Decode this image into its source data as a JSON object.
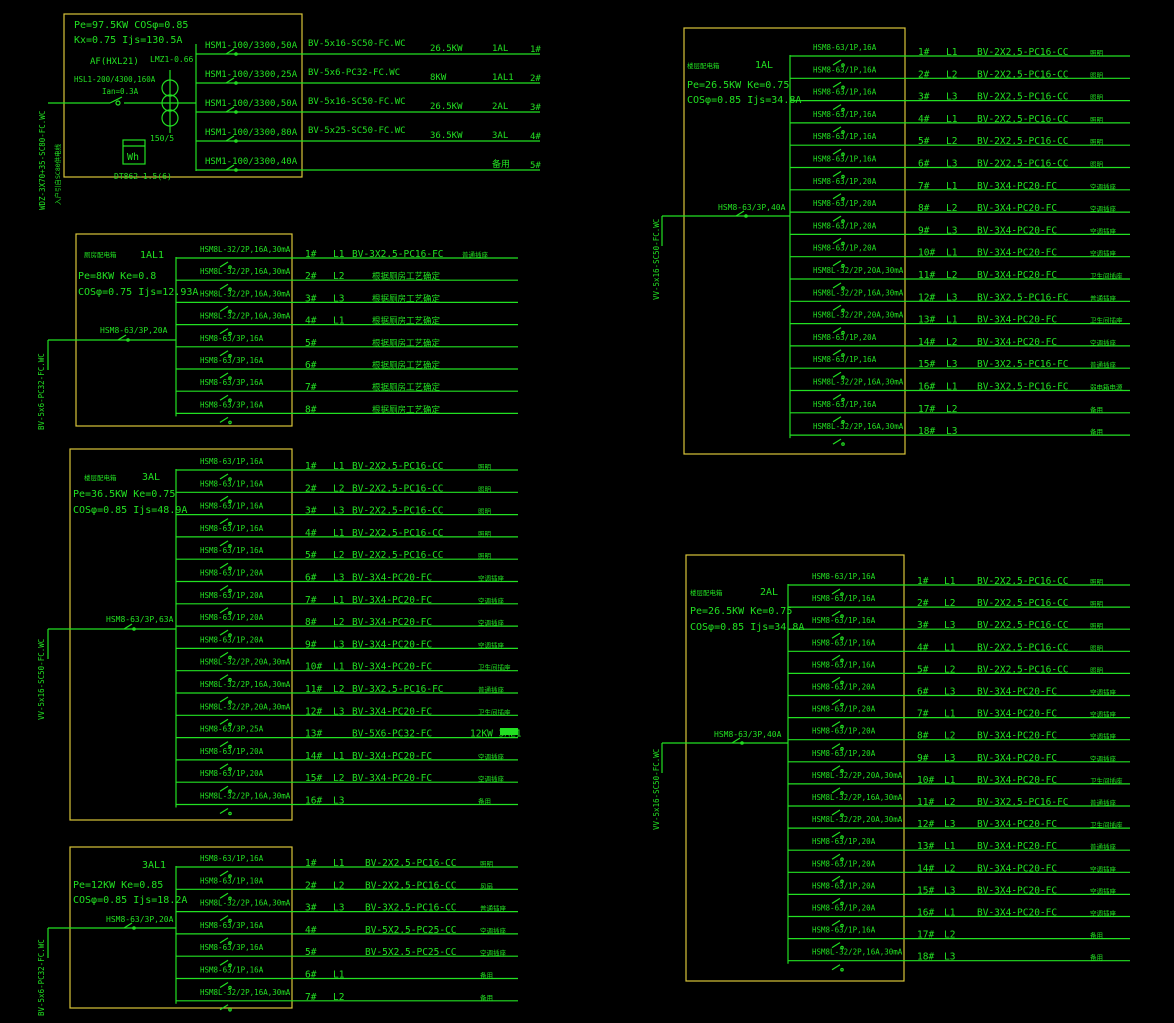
{
  "colors": {
    "background": "#000000",
    "lines": "#22e022",
    "frames": "#d8c43a"
  },
  "main": {
    "params1": "Pe=97.5KW  COSφ=0.85",
    "params2": "Kx=0.75    Ijs=130.5A",
    "meter_box": "AF(HXL21)",
    "ct": "LMZ1-0.66",
    "breaker": "HSL1-200/4300,160A",
    "breaker_in": "Ian=0.3A",
    "ct_ratio": "150/5",
    "meter_icon": "Wh",
    "meter": "DT862-1.5(6)",
    "incoming": "WDZ-3X70+35-SC80-FC.WC",
    "incoming_note": "入户引自SC80供电线",
    "rows": [
      {
        "breaker": "HSM1-100/3300,50A",
        "cable": "BV-5x16-SC50-FC.WC",
        "kw": "26.5KW",
        "dest": "1AL",
        "no": "1#"
      },
      {
        "breaker": "HSM1-100/3300,25A",
        "cable": "BV-5x6-PC32-FC.WC",
        "kw": "8KW",
        "dest": "1AL1",
        "no": "2#"
      },
      {
        "breaker": "HSM1-100/3300,50A",
        "cable": "BV-5x16-SC50-FC.WC",
        "kw": "26.5KW",
        "dest": "2AL",
        "no": "3#"
      },
      {
        "breaker": "HSM1-100/3300,80A",
        "cable": "BV-5x25-SC50-FC.WC",
        "kw": "36.5KW",
        "dest": "3AL",
        "no": "4#"
      },
      {
        "breaker": "HSM1-100/3300,40A",
        "cable": "",
        "kw": "",
        "dest": "备用",
        "no": "5#"
      }
    ]
  },
  "panels": [
    {
      "id": "1AL1",
      "label_small": "厕房配电箱",
      "title": "1AL1",
      "params": [
        "Pe=8KW Ke=0.8",
        "COSφ=0.75 Ijs=12.93A"
      ],
      "main_breaker": "HSM8-63/3P,20A",
      "incoming": "BV-5x6-PC32-FC.WC",
      "rows": [
        {
          "breaker": "HSM8L-32/2P,16A,30mA",
          "no": "1#",
          "phase": "L1",
          "cable": "BV-3X2.5-PC16-FC",
          "use": "普通插座"
        },
        {
          "breaker": "HSM8L-32/2P,16A,30mA",
          "no": "2#",
          "phase": "L2",
          "cable": "根据厕房工艺确定",
          "use": ""
        },
        {
          "breaker": "HSM8L-32/2P,16A,30mA",
          "no": "3#",
          "phase": "L3",
          "cable": "根据厕房工艺确定",
          "use": ""
        },
        {
          "breaker": "HSM8L-32/2P,16A,30mA",
          "no": "4#",
          "phase": "L1",
          "cable": "根据厕房工艺确定",
          "use": ""
        },
        {
          "breaker": "HSM8-63/3P,16A",
          "no": "5#",
          "phase": "",
          "cable": "根据厕房工艺确定",
          "use": ""
        },
        {
          "breaker": "HSM8-63/3P,16A",
          "no": "6#",
          "phase": "",
          "cable": "根据厕房工艺确定",
          "use": ""
        },
        {
          "breaker": "HSM8-63/3P,16A",
          "no": "7#",
          "phase": "",
          "cable": "根据厕房工艺确定",
          "use": ""
        },
        {
          "breaker": "HSM8-63/3P,16A",
          "no": "8#",
          "phase": "",
          "cable": "根据厕房工艺确定",
          "use": ""
        }
      ]
    },
    {
      "id": "3AL",
      "label_small": "楼层配电箱",
      "title": "3AL",
      "params": [
        "Pe=36.5KW Ke=0.75",
        "COSφ=0.85 Ijs=48.9A"
      ],
      "main_breaker": "HSM8-63/3P,63A",
      "incoming": "VV-5x16-SC50-FC.WC",
      "rows": [
        {
          "breaker": "HSM8-63/1P,16A",
          "no": "1#",
          "phase": "L1",
          "cable": "BV-2X2.5-PC16-CC",
          "use": "照明"
        },
        {
          "breaker": "HSM8-63/1P,16A",
          "no": "2#",
          "phase": "L2",
          "cable": "BV-2X2.5-PC16-CC",
          "use": "照明"
        },
        {
          "breaker": "HSM8-63/1P,16A",
          "no": "3#",
          "phase": "L3",
          "cable": "BV-2X2.5-PC16-CC",
          "use": "照明"
        },
        {
          "breaker": "HSM8-63/1P,16A",
          "no": "4#",
          "phase": "L1",
          "cable": "BV-2X2.5-PC16-CC",
          "use": "照明"
        },
        {
          "breaker": "HSM8-63/1P,16A",
          "no": "5#",
          "phase": "L2",
          "cable": "BV-2X2.5-PC16-CC",
          "use": "照明"
        },
        {
          "breaker": "HSM8-63/1P,20A",
          "no": "6#",
          "phase": "L3",
          "cable": "BV-3X4-PC20-FC",
          "use": "空调插座"
        },
        {
          "breaker": "HSM8-63/1P,20A",
          "no": "7#",
          "phase": "L1",
          "cable": "BV-3X4-PC20-FC",
          "use": "空调插座"
        },
        {
          "breaker": "HSM8-63/1P,20A",
          "no": "8#",
          "phase": "L2",
          "cable": "BV-3X4-PC20-FC",
          "use": "空调插座"
        },
        {
          "breaker": "HSM8-63/1P,20A",
          "no": "9#",
          "phase": "L3",
          "cable": "BV-3X4-PC20-FC",
          "use": "空调插座"
        },
        {
          "breaker": "HSM8L-32/2P,20A,30mA",
          "no": "10#",
          "phase": "L1",
          "cable": "BV-3X4-PC20-FC",
          "use": "卫生间插座"
        },
        {
          "breaker": "HSM8L-32/2P,16A,30mA",
          "no": "11#",
          "phase": "L2",
          "cable": "BV-3X2.5-PC16-FC",
          "use": "普通插座"
        },
        {
          "breaker": "HSM8L-32/2P,20A,30mA",
          "no": "12#",
          "phase": "L3",
          "cable": "BV-3X4-PC20-FC",
          "use": "卫生间插座"
        },
        {
          "breaker": "HSM8-63/3P,25A",
          "no": "13#",
          "phase": "",
          "cable": "BV-5X6-PC32-FC",
          "use": "12KW  3AL1"
        },
        {
          "breaker": "HSM8-63/1P,20A",
          "no": "14#",
          "phase": "L1",
          "cable": "BV-3X4-PC20-FC",
          "use": "空调插座"
        },
        {
          "breaker": "HSM8-63/1P,20A",
          "no": "15#",
          "phase": "L2",
          "cable": "BV-3X4-PC20-FC",
          "use": "空调插座"
        },
        {
          "breaker": "HSM8L-32/2P,16A,30mA",
          "no": "16#",
          "phase": "L3",
          "cable": "",
          "use": "备用"
        }
      ]
    },
    {
      "id": "3AL1",
      "label_small": "",
      "title": "3AL1",
      "params": [
        "Pe=12KW Ke=0.85",
        "COSφ=0.85 Ijs=18.2A"
      ],
      "main_breaker": "HSM8-63/3P,20A",
      "incoming": "BV-5x6-PC32-FC.WC",
      "rows": [
        {
          "breaker": "HSM8-63/1P,16A",
          "no": "1#",
          "phase": "L1",
          "cable": "BV-2X2.5-PC16-CC",
          "use": "照明"
        },
        {
          "breaker": "HSM8-63/1P,10A",
          "no": "2#",
          "phase": "L2",
          "cable": "BV-2X2.5-PC16-CC",
          "use": "风扇"
        },
        {
          "breaker": "HSM8L-32/2P,16A,30mA",
          "no": "3#",
          "phase": "L3",
          "cable": "BV-3X2.5-PC16-CC",
          "use": "普通插座"
        },
        {
          "breaker": "HSM8-63/3P,16A",
          "no": "4#",
          "phase": "",
          "cable": "BV-5X2.5-PC25-CC",
          "use": "空调插座"
        },
        {
          "breaker": "HSM8-63/3P,16A",
          "no": "5#",
          "phase": "",
          "cable": "BV-5X2.5-PC25-CC",
          "use": "空调插座"
        },
        {
          "breaker": "HSM8-63/1P,16A",
          "no": "6#",
          "phase": "L1",
          "cable": "",
          "use": "备用"
        },
        {
          "breaker": "HSM8L-32/2P,16A,30mA",
          "no": "7#",
          "phase": "L2",
          "cable": "",
          "use": "备用"
        }
      ]
    },
    {
      "id": "1AL",
      "label_small": "楼层配电箱",
      "title": "1AL",
      "params": [
        "Pe=26.5KW Ke=0.75",
        "COSφ=0.85 Ijs=34.8A"
      ],
      "main_breaker": "HSM8-63/3P,40A",
      "incoming": "VV-5x16-SC50-FC.WC",
      "rows": [
        {
          "breaker": "HSM8-63/1P,16A",
          "no": "1#",
          "phase": "L1",
          "cable": "BV-2X2.5-PC16-CC",
          "use": "照明"
        },
        {
          "breaker": "HSM8-63/1P,16A",
          "no": "2#",
          "phase": "L2",
          "cable": "BV-2X2.5-PC16-CC",
          "use": "照明"
        },
        {
          "breaker": "HSM8-63/1P,16A",
          "no": "3#",
          "phase": "L3",
          "cable": "BV-2X2.5-PC16-CC",
          "use": "照明"
        },
        {
          "breaker": "HSM8-63/1P,16A",
          "no": "4#",
          "phase": "L1",
          "cable": "BV-2X2.5-PC16-CC",
          "use": "照明"
        },
        {
          "breaker": "HSM8-63/1P,16A",
          "no": "5#",
          "phase": "L2",
          "cable": "BV-2X2.5-PC16-CC",
          "use": "照明"
        },
        {
          "breaker": "HSM8-63/1P,16A",
          "no": "6#",
          "phase": "L3",
          "cable": "BV-2X2.5-PC16-CC",
          "use": "照明"
        },
        {
          "breaker": "HSM8-63/1P,20A",
          "no": "7#",
          "phase": "L1",
          "cable": "BV-3X4-PC20-FC",
          "use": "空调插座"
        },
        {
          "breaker": "HSM8-63/1P,20A",
          "no": "8#",
          "phase": "L2",
          "cable": "BV-3X4-PC20-FC",
          "use": "空调插座"
        },
        {
          "breaker": "HSM8-63/1P,20A",
          "no": "9#",
          "phase": "L3",
          "cable": "BV-3X4-PC20-FC",
          "use": "空调插座"
        },
        {
          "breaker": "HSM8-63/1P,20A",
          "no": "10#",
          "phase": "L1",
          "cable": "BV-3X4-PC20-FC",
          "use": "空调插座"
        },
        {
          "breaker": "HSM8L-32/2P,20A,30mA",
          "no": "11#",
          "phase": "L2",
          "cable": "BV-3X4-PC20-FC",
          "use": "卫生间插座"
        },
        {
          "breaker": "HSM8L-32/2P,16A,30mA",
          "no": "12#",
          "phase": "L3",
          "cable": "BV-3X2.5-PC16-FC",
          "use": "普通插座"
        },
        {
          "breaker": "HSM8L-32/2P,20A,30mA",
          "no": "13#",
          "phase": "L1",
          "cable": "BV-3X4-PC20-FC",
          "use": "卫生间插座"
        },
        {
          "breaker": "HSM8-63/1P,20A",
          "no": "14#",
          "phase": "L2",
          "cable": "BV-3X4-PC20-FC",
          "use": "空调插座"
        },
        {
          "breaker": "HSM8-63/1P,16A",
          "no": "15#",
          "phase": "L3",
          "cable": "BV-3X2.5-PC16-FC",
          "use": "普通插座"
        },
        {
          "breaker": "HSM8L-32/2P,16A,30mA",
          "no": "16#",
          "phase": "L1",
          "cable": "BV-3X2.5-PC16-FC",
          "use": "弱电箱电源"
        },
        {
          "breaker": "HSM8-63/1P,16A",
          "no": "17#",
          "phase": "L2",
          "cable": "",
          "use": "备用"
        },
        {
          "breaker": "HSM8L-32/2P,16A,30mA",
          "no": "18#",
          "phase": "L3",
          "cable": "",
          "use": "备用"
        }
      ]
    },
    {
      "id": "2AL",
      "label_small": "楼层配电箱",
      "title": "2AL",
      "params": [
        "Pe=26.5KW Ke=0.75",
        "COSφ=0.85 Ijs=34.8A"
      ],
      "main_breaker": "HSM8-63/3P,40A",
      "incoming": "VV-5x16-SC50-FC.WC",
      "rows": [
        {
          "breaker": "HSM8-63/1P,16A",
          "no": "1#",
          "phase": "L1",
          "cable": "BV-2X2.5-PC16-CC",
          "use": "照明"
        },
        {
          "breaker": "HSM8-63/1P,16A",
          "no": "2#",
          "phase": "L2",
          "cable": "BV-2X2.5-PC16-CC",
          "use": "照明"
        },
        {
          "breaker": "HSM8-63/1P,16A",
          "no": "3#",
          "phase": "L3",
          "cable": "BV-2X2.5-PC16-CC",
          "use": "照明"
        },
        {
          "breaker": "HSM8-63/1P,16A",
          "no": "4#",
          "phase": "L1",
          "cable": "BV-2X2.5-PC16-CC",
          "use": "照明"
        },
        {
          "breaker": "HSM8-63/1P,16A",
          "no": "5#",
          "phase": "L2",
          "cable": "BV-2X2.5-PC16-CC",
          "use": "照明"
        },
        {
          "breaker": "HSM8-63/1P,20A",
          "no": "6#",
          "phase": "L3",
          "cable": "BV-3X4-PC20-FC",
          "use": "空调插座"
        },
        {
          "breaker": "HSM8-63/1P,20A",
          "no": "7#",
          "phase": "L1",
          "cable": "BV-3X4-PC20-FC",
          "use": "空调插座"
        },
        {
          "breaker": "HSM8-63/1P,20A",
          "no": "8#",
          "phase": "L2",
          "cable": "BV-3X4-PC20-FC",
          "use": "空调插座"
        },
        {
          "breaker": "HSM8-63/1P,20A",
          "no": "9#",
          "phase": "L3",
          "cable": "BV-3X4-PC20-FC",
          "use": "空调插座"
        },
        {
          "breaker": "HSM8L-32/2P,20A,30mA",
          "no": "10#",
          "phase": "L1",
          "cable": "BV-3X4-PC20-FC",
          "use": "卫生间插座"
        },
        {
          "breaker": "HSM8L-32/2P,16A,30mA",
          "no": "11#",
          "phase": "L2",
          "cable": "BV-3X2.5-PC16-FC",
          "use": "普通插座"
        },
        {
          "breaker": "HSM8L-32/2P,20A,30mA",
          "no": "12#",
          "phase": "L3",
          "cable": "BV-3X4-PC20-FC",
          "use": "卫生间插座"
        },
        {
          "breaker": "HSM8-63/1P,20A",
          "no": "13#",
          "phase": "L1",
          "cable": "BV-3X4-PC20-FC",
          "use": "普通插座"
        },
        {
          "breaker": "HSM8-63/1P,20A",
          "no": "14#",
          "phase": "L2",
          "cable": "BV-3X4-PC20-FC",
          "use": "空调插座"
        },
        {
          "breaker": "HSM8-63/1P,20A",
          "no": "15#",
          "phase": "L3",
          "cable": "BV-3X4-PC20-FC",
          "use": "空调插座"
        },
        {
          "breaker": "HSM8-63/1P,20A",
          "no": "16#",
          "phase": "L1",
          "cable": "BV-3X4-PC20-FC",
          "use": "空调插座"
        },
        {
          "breaker": "HSM8-63/1P,16A",
          "no": "17#",
          "phase": "L2",
          "cable": "",
          "use": "备用"
        },
        {
          "breaker": "HSM8L-32/2P,16A,30mA",
          "no": "18#",
          "phase": "L3",
          "cable": "",
          "use": "备用"
        }
      ]
    }
  ]
}
